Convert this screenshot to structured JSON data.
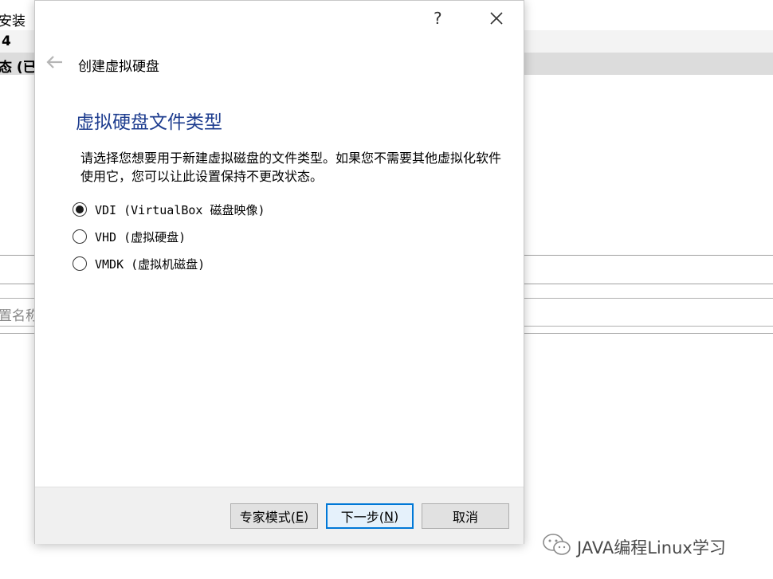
{
  "background_app": {
    "line1": "安装",
    "line2": "4",
    "line3": "态 (已",
    "field_placeholder": "置名称"
  },
  "dialog": {
    "help_label": "?",
    "heading": "创建虚拟硬盘",
    "page_title": "虚拟硬盘文件类型",
    "description": "请选择您想要用于新建虚拟磁盘的文件类型。如果您不需要其他虚拟化软件使用它，您可以让此设置保持不更改状态。",
    "options": [
      {
        "label": "VDI (VirtualBox 磁盘映像)",
        "checked": true
      },
      {
        "label": "VHD (虚拟硬盘)",
        "checked": false
      },
      {
        "label": "VMDK (虚拟机磁盘)",
        "checked": false
      }
    ],
    "buttons": {
      "expert": {
        "text": "专家模式(",
        "mnemonic": "E",
        "suffix": ")"
      },
      "next": {
        "text": "下一步(",
        "mnemonic": "N",
        "suffix": ")"
      },
      "cancel": "取消"
    }
  },
  "watermark": "JAVA编程Linux学习",
  "colors": {
    "title_blue": "#1e3d8f",
    "default_button_border": "#0078d7",
    "footer_bg": "#f0f0f0"
  }
}
